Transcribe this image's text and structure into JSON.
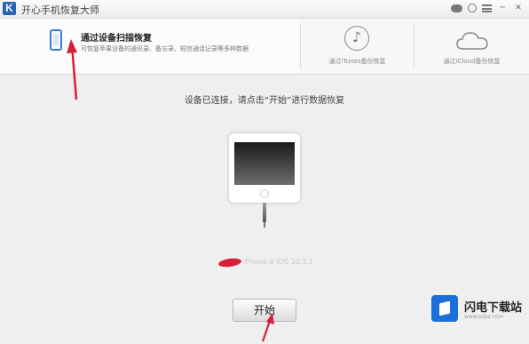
{
  "app": {
    "logo_letter": "K",
    "title": "开心手机恢复大师"
  },
  "tabs": {
    "device": {
      "title": "通过设备扫描恢复",
      "description": "可恢复苹果设备的通讯录、备忘录、短信通话记录等多种数据"
    },
    "itunes": {
      "label": "通过iTunes备份恢复",
      "icon": "music-note-icon"
    },
    "icloud": {
      "label": "通过iCloud备份恢复",
      "icon": "cloud-icon"
    }
  },
  "main": {
    "instruction": "设备已连接，请点击“开始”进行数据恢复",
    "device_info": "iPhone 6 iOS 10.3.2",
    "start_label": "开始"
  },
  "watermark": {
    "brand": "闪电下载站",
    "url": "www.sdxz.com"
  },
  "colors": {
    "accent_blue": "#3a7bd5",
    "annotation_red": "#d51f3a",
    "background": "#efefef"
  }
}
